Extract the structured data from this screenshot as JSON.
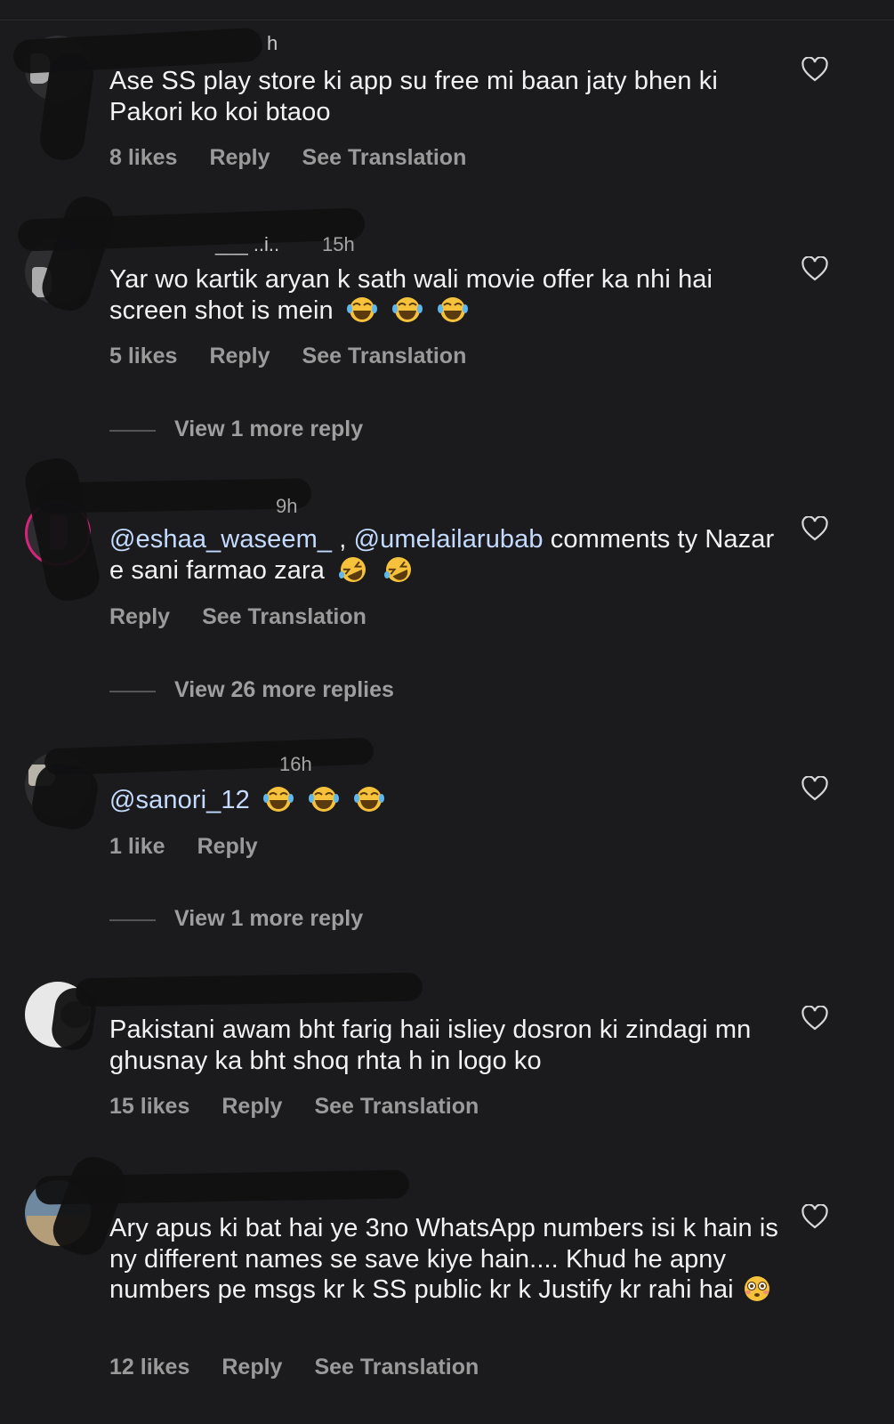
{
  "comments": [
    {
      "username_tail": "h",
      "time": "",
      "text": "Ase SS play store ki app su free mi baan jaty bhen ki Pakori ko koi btaoo",
      "likes": "8 likes",
      "reply": "Reply",
      "translate": "See Translation"
    },
    {
      "username_tail": "___ ..i..",
      "time": "15h",
      "text": "Yar wo kartik aryan k sath wali movie offer ka nhi hai screen shot is mein",
      "emojis": [
        "tears-of-joy-emoji",
        "tears-of-joy-emoji",
        "tears-of-joy-emoji"
      ],
      "likes": "5 likes",
      "reply": "Reply",
      "translate": "See Translation",
      "view_more": "View 1 more reply"
    },
    {
      "time": "9h",
      "mention1": "@eshaa_waseem_",
      "separator": " , ",
      "mention2": "@umelailarubab",
      "text_after": " comments ty Nazar e sani farmao zara",
      "emojis": [
        "rolling-laughing-emoji",
        "rolling-laughing-emoji"
      ],
      "reply": "Reply",
      "translate": "See Translation",
      "view_more": "View 26 more replies"
    },
    {
      "time": "16h",
      "mention": "@sanori_12",
      "emojis": [
        "tears-of-joy-emoji",
        "tears-of-joy-emoji",
        "tears-of-joy-emoji"
      ],
      "likes": "1 like",
      "reply": "Reply",
      "view_more": "View 1 more reply"
    },
    {
      "text": "Pakistani awam bht farig haii isliey dosron ki zindagi mn ghusnay ka bht shoq rhta h in logo ko",
      "likes": "15 likes",
      "reply": "Reply",
      "translate": "See Translation"
    },
    {
      "text": "Ary apus ki bat hai ye 3no WhatsApp numbers isi k hain is ny different names se save kiye hain.... Khud he apny numbers pe msgs kr k SS public kr k Justify kr rahi hai",
      "emojis": [
        "flushed-face-emoji"
      ],
      "likes": "12 likes",
      "reply": "Reply",
      "translate": "See Translation"
    }
  ],
  "icons": {
    "like": "heart-outline-icon"
  },
  "colors": {
    "background": "#1b1b1d",
    "text": "#f2f2f2",
    "meta": "#9a9a9a",
    "mention": "#c4dbff"
  }
}
